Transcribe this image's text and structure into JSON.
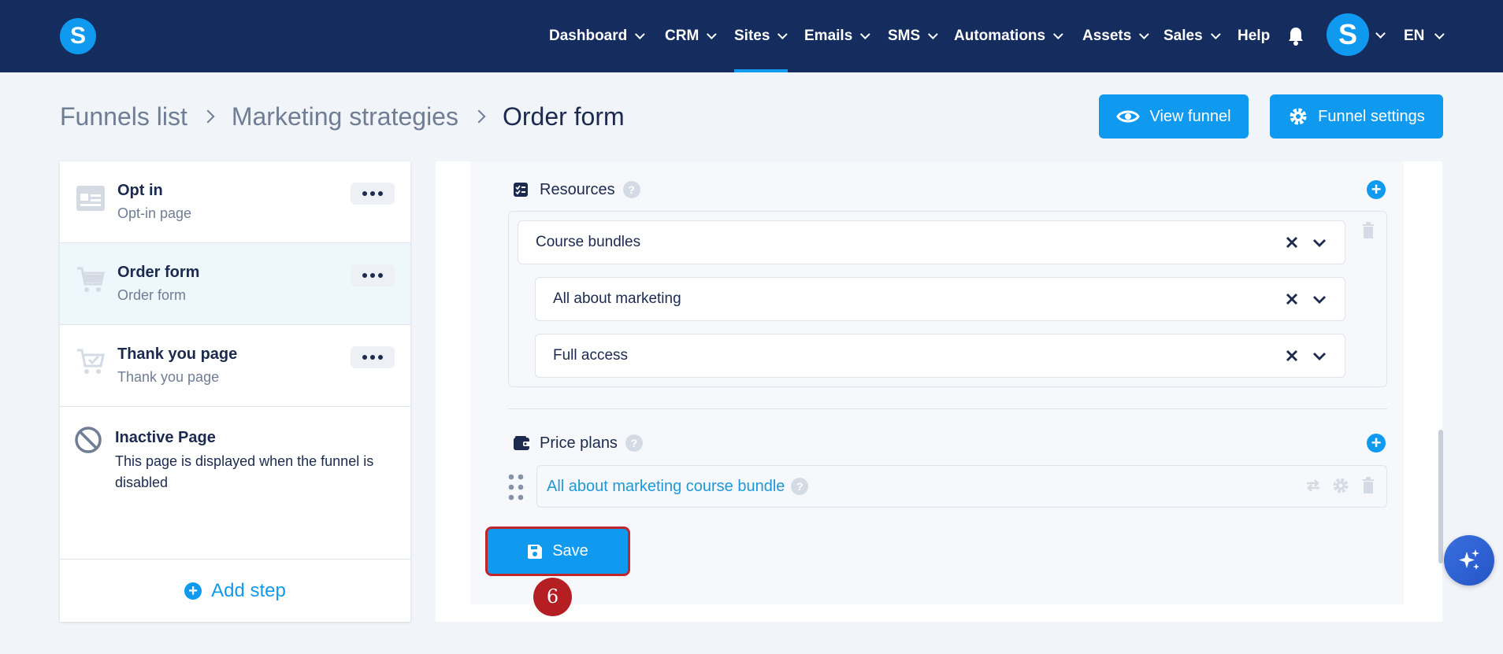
{
  "app": {
    "logo_letter": "S",
    "avatar_letter": "S",
    "language": "EN"
  },
  "nav": {
    "items": [
      {
        "label": "Dashboard"
      },
      {
        "label": "CRM"
      },
      {
        "label": "Sites"
      },
      {
        "label": "Emails"
      },
      {
        "label": "SMS"
      },
      {
        "label": "Automations"
      },
      {
        "label": "Assets"
      },
      {
        "label": "Sales"
      }
    ],
    "active": "Sites",
    "help_label": "Help"
  },
  "breadcrumb": {
    "items": [
      "Funnels list",
      "Marketing strategies"
    ],
    "current": "Order form"
  },
  "header_actions": {
    "view_funnel": "View funnel",
    "funnel_settings": "Funnel settings"
  },
  "steps": [
    {
      "title": "Opt in",
      "subtitle": "Opt-in page",
      "icon": "opt-in-page-icon"
    },
    {
      "title": "Order form",
      "subtitle": "Order form",
      "icon": "cart-icon",
      "active": true
    },
    {
      "title": "Thank you page",
      "subtitle": "Thank you page",
      "icon": "cart-check-icon"
    }
  ],
  "inactive_page": {
    "title": "Inactive Page",
    "description": "This page is displayed when the funnel is disabled"
  },
  "add_step_label": "Add step",
  "resources": {
    "label": "Resources",
    "help": "?",
    "selects": [
      {
        "value": "Course bundles"
      },
      {
        "value": "All about marketing"
      },
      {
        "value": "Full access"
      }
    ]
  },
  "price_plans": {
    "label": "Price plans",
    "help": "?",
    "items": [
      {
        "name": "All about marketing course bundle",
        "help": "?"
      }
    ]
  },
  "save_label": "Save",
  "annotation_step": "6",
  "colors": {
    "nav_bg": "#152c5f",
    "accent": "#0f9af0",
    "highlight": "#c0272d"
  }
}
